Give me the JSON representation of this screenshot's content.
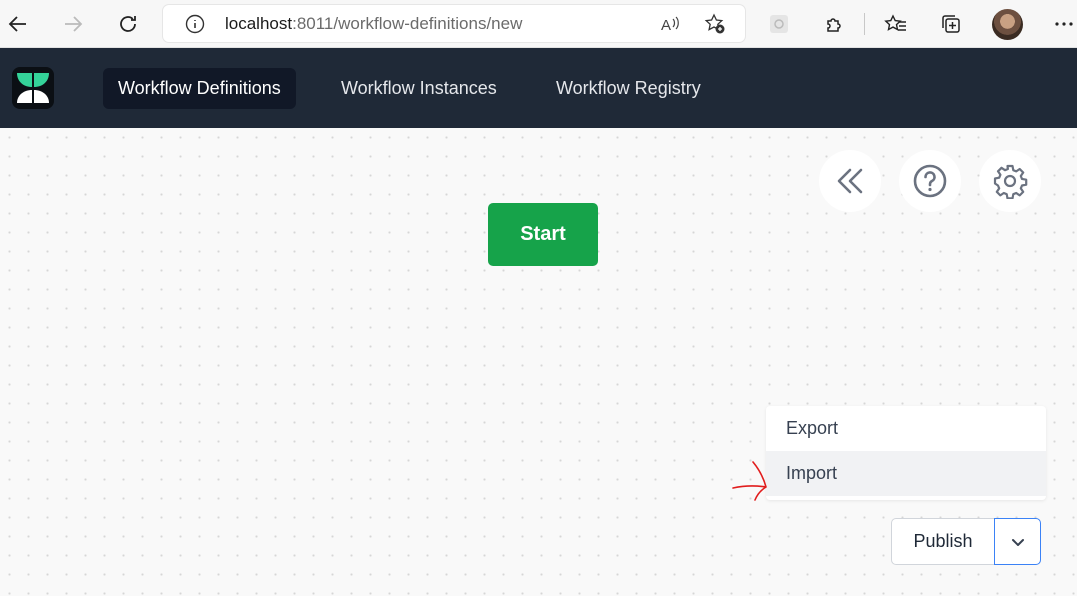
{
  "browser": {
    "url_host": "localhost",
    "url_path": ":8011/workflow-definitions/new"
  },
  "header": {
    "nav": [
      {
        "label": "Workflow Definitions"
      },
      {
        "label": "Workflow Instances"
      },
      {
        "label": "Workflow Registry"
      }
    ]
  },
  "canvas": {
    "start_label": "Start",
    "toolbar_icons": [
      "collapse-left-icon",
      "help-icon",
      "settings-icon"
    ]
  },
  "menu": {
    "items": [
      {
        "label": "Export"
      },
      {
        "label": "Import"
      }
    ]
  },
  "publish": {
    "label": "Publish"
  },
  "colors": {
    "header_bg": "#1f2937",
    "start_green": "#16a34a",
    "toggle_border": "#3b82f6",
    "annotation_red": "#e11d1d"
  }
}
